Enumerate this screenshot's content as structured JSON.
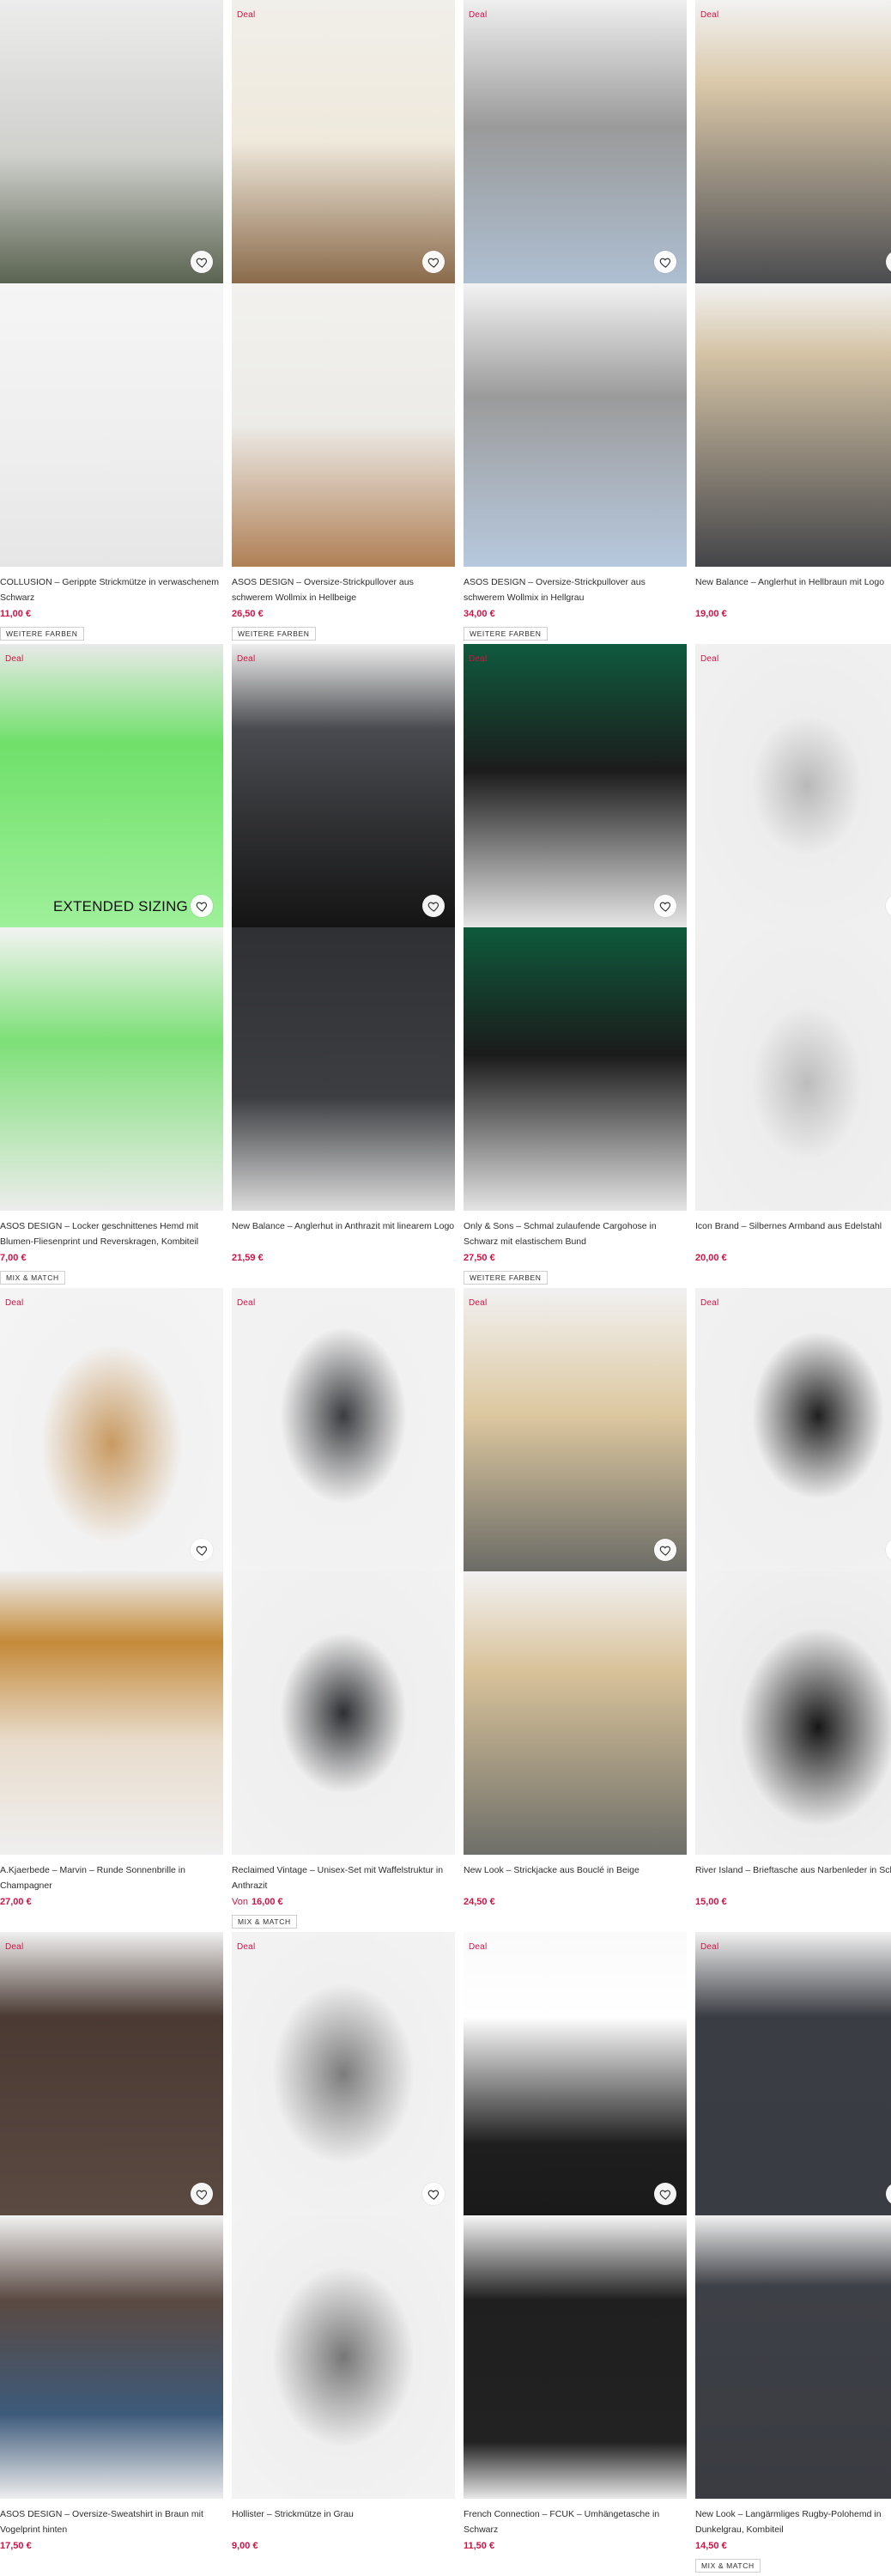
{
  "ui": {
    "deal_label": "Deal",
    "accent_color": "#d01345",
    "heart_icon": "heart-outline-icon"
  },
  "products": [
    {
      "title": "COLLUSION – Gerippte Strickmütze in verwaschenem Schwarz",
      "price_prefix": "",
      "price": "11,00 €",
      "chip": "WEITERE FARBEN",
      "overlay": ""
    },
    {
      "title": "ASOS DESIGN – Oversize-Strickpullover aus schwerem Wollmix in Hellbeige",
      "price_prefix": "",
      "price": "26,50 €",
      "chip": "WEITERE FARBEN",
      "overlay": ""
    },
    {
      "title": "ASOS DESIGN – Oversize-Strickpullover aus schwerem Wollmix in Hellgrau",
      "price_prefix": "",
      "price": "34,00 €",
      "chip": "WEITERE FARBEN",
      "overlay": ""
    },
    {
      "title": "New Balance – Anglerhut in Hellbraun mit Logo",
      "price_prefix": "",
      "price": "19,00 €",
      "chip": "",
      "overlay": ""
    },
    {
      "title": "ASOS DESIGN – Locker geschnittenes Hemd mit Blumen-Fliesenprint und Reverskragen, Kombiteil",
      "price_prefix": "",
      "price": "7,00 €",
      "chip": "MIX & MATCH",
      "overlay": "EXTENDED SIZING"
    },
    {
      "title": "New Balance – Anglerhut in Anthrazit mit linearem Logo",
      "price_prefix": "",
      "price": "21,59 €",
      "chip": "",
      "overlay": ""
    },
    {
      "title": "Only & Sons – Schmal zulaufende Cargohose in Schwarz mit elastischem Bund",
      "price_prefix": "",
      "price": "27,50 €",
      "chip": "WEITERE FARBEN",
      "overlay": ""
    },
    {
      "title": "Icon Brand – Silbernes Armband aus Edelstahl",
      "price_prefix": "",
      "price": "20,00 €",
      "chip": "",
      "overlay": ""
    },
    {
      "title": "A.Kjaerbede – Marvin – Runde Sonnenbrille in Champagner",
      "price_prefix": "",
      "price": "27,00 €",
      "chip": "",
      "overlay": ""
    },
    {
      "title": "Reclaimed Vintage – Unisex-Set mit Waffelstruktur in Anthrazit",
      "price_prefix": "Von",
      "price": "16,00 €",
      "chip": "MIX & MATCH",
      "overlay": ""
    },
    {
      "title": "New Look – Strickjacke aus Bouclé in Beige",
      "price_prefix": "",
      "price": "24,50 €",
      "chip": "",
      "overlay": ""
    },
    {
      "title": "River Island – Brieftasche aus Narbenleder in Schwarz",
      "price_prefix": "",
      "price": "15,00 €",
      "chip": "",
      "overlay": ""
    },
    {
      "title": "ASOS DESIGN – Oversize-Sweatshirt in Braun mit Vogelprint hinten",
      "price_prefix": "",
      "price": "17,50 €",
      "chip": "",
      "overlay": ""
    },
    {
      "title": "Hollister – Strickmütze in Grau",
      "price_prefix": "",
      "price": "9,00 €",
      "chip": "",
      "overlay": ""
    },
    {
      "title": "French Connection – FCUK – Umhängetasche in Schwarz",
      "price_prefix": "",
      "price": "11,50 €",
      "chip": "",
      "overlay": ""
    },
    {
      "title": "New Look – Langärmliges Rugby-Polohemd in Dunkelgrau, Kombiteil",
      "price_prefix": "",
      "price": "14,50 €",
      "chip": "MIX & MATCH",
      "overlay": ""
    }
  ]
}
